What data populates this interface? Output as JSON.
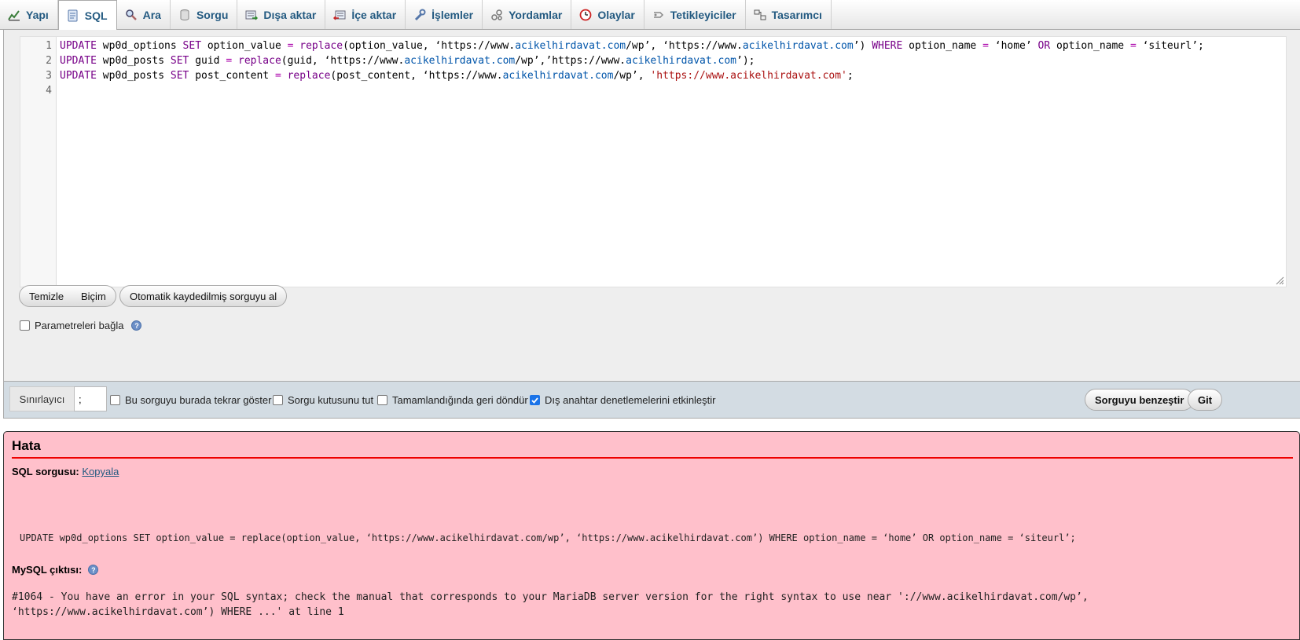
{
  "tabs": [
    {
      "label": "Yapı",
      "icon": "structure-icon"
    },
    {
      "label": "SQL",
      "icon": "sql-icon",
      "active": true
    },
    {
      "label": "Ara",
      "icon": "search-icon"
    },
    {
      "label": "Sorgu",
      "icon": "query-icon"
    },
    {
      "label": "Dışa aktar",
      "icon": "export-icon"
    },
    {
      "label": "İçe aktar",
      "icon": "import-icon"
    },
    {
      "label": "İşlemler",
      "icon": "wrench-icon"
    },
    {
      "label": "Yordamlar",
      "icon": "routines-icon"
    },
    {
      "label": "Olaylar",
      "icon": "clock-icon"
    },
    {
      "label": "Tetikleyiciler",
      "icon": "triggers-icon"
    },
    {
      "label": "Tasarımcı",
      "icon": "designer-icon"
    }
  ],
  "editor": {
    "line_numbers": [
      "1",
      "2",
      "3",
      "4"
    ],
    "lines": [
      "UPDATE wp0d_options SET option_value = replace(option_value, ‘https://www.acikelhirdavat.com/wp’, ‘https://www.acikelhirdavat.com’) WHERE option_name = ‘home’ OR option_name = ‘siteurl’;",
      "UPDATE wp0d_posts SET guid = replace(guid, ‘https://www.acikelhirdavat.com/wp’,’https://www.acikelhirdavat.com’);",
      "UPDATE wp0d_posts SET post_content = replace(post_content, ‘https://www.acikelhirdavat.com/wp’, 'https://www.acikelhirdavat.com';",
      ""
    ]
  },
  "buttons": {
    "clear": "Temizle",
    "format": "Biçim",
    "autosaved": "Otomatik kaydedilmiş sorguyu al",
    "simulate": "Sorguyu benzeştir",
    "go": "Git"
  },
  "bind_params": {
    "label": "Parametreleri bağla",
    "checked": false
  },
  "options": {
    "delimiter_label": "Sınırlayıcı",
    "delimiter_value": ";",
    "show_again": {
      "label": "Bu sorguyu burada tekrar göster",
      "checked": false
    },
    "retain_box": {
      "label": "Sorgu kutusunu tut",
      "checked": false
    },
    "rollback": {
      "label": "Tamamlandığında geri döndür",
      "checked": false
    },
    "foreign_keys": {
      "label": "Dış anahtar denetlemelerini etkinleştir",
      "checked": true
    }
  },
  "error": {
    "title": "Hata",
    "sql_query_label": "SQL sorgusu:",
    "copy_link": "Kopyala",
    "query": "UPDATE wp0d_options SET option_value = replace(option_value, ‘https://www.acikelhirdavat.com/wp’, ‘https://www.acikelhirdavat.com’) WHERE option_name = ‘home’ OR option_name = ‘siteurl’;",
    "mysql_output_label": "MySQL çıktısı:",
    "message_line1": "#1064 - You have an error in your SQL syntax; check the manual that corresponds to your MariaDB server version for the right syntax to use near '://www.acikelhirdavat.com/wp’,",
    "message_line2": "‘https://www.acikelhirdavat.com’) WHERE ...' at line 1"
  },
  "colors": {
    "tab_text": "#235a81",
    "error_bg": "#ffc0cb",
    "error_rule": "#ee0000",
    "sql_keyword": "#770088",
    "sql_url": "#0055aa",
    "sql_string": "#aa1111"
  }
}
